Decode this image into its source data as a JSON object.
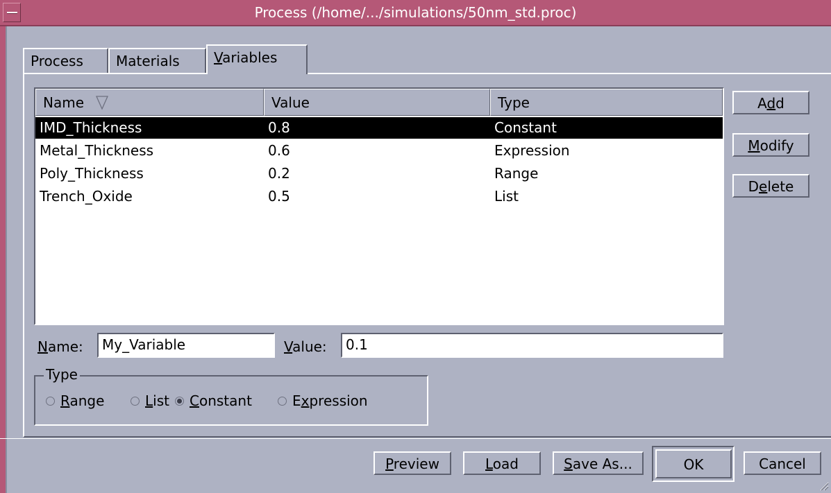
{
  "window": {
    "title": "Process (/home/.../simulations/50nm_std.proc)"
  },
  "tabs": [
    {
      "label": "Process",
      "active": false
    },
    {
      "label": "Materials",
      "active": false
    },
    {
      "label_pre": "",
      "label_mn": "V",
      "label_post": "ariables",
      "active": true
    }
  ],
  "table": {
    "columns": [
      {
        "label": "Name"
      },
      {
        "label": "Value"
      },
      {
        "label": "Type"
      }
    ],
    "sort_column": "Name",
    "rows": [
      {
        "name": "IMD_Thickness",
        "value": "0.8",
        "type": "Constant",
        "selected": true
      },
      {
        "name": "Metal_Thickness",
        "value": "0.6",
        "type": "Expression",
        "selected": false
      },
      {
        "name": "Poly_Thickness",
        "value": "0.2",
        "type": "Range",
        "selected": false
      },
      {
        "name": "Trench_Oxide",
        "value": "0.5",
        "type": "List",
        "selected": false
      }
    ]
  },
  "side_buttons": {
    "add": {
      "pre": "A",
      "mn": "d",
      "post": "d"
    },
    "modify": {
      "pre": "",
      "mn": "M",
      "post": "odify"
    },
    "delete": {
      "pre": "D",
      "mn": "e",
      "post": "lete"
    }
  },
  "form": {
    "name_label": {
      "mn": "N",
      "post": "ame:"
    },
    "name_value": "My_Variable",
    "value_label": {
      "mn": "V",
      "post": "alue:"
    },
    "value_value": "0.1"
  },
  "type_group": {
    "title": "Type",
    "options": [
      {
        "pre": "",
        "mn": "R",
        "post": "ange",
        "checked": false
      },
      {
        "pre": "",
        "mn": "L",
        "post": "ist",
        "checked": false
      },
      {
        "pre": "",
        "mn": "C",
        "post": "onstant",
        "checked": true
      },
      {
        "pre": "E",
        "mn": "x",
        "post": "pression",
        "checked": false
      }
    ]
  },
  "footer_buttons": {
    "preview": {
      "mn": "P",
      "post": "review"
    },
    "load": {
      "mn": "L",
      "post": "oad"
    },
    "save_as": {
      "mn": "S",
      "post": "ave As..."
    },
    "ok": "OK",
    "cancel": "Cancel"
  },
  "colors": {
    "titlebar": "#b55877",
    "dialog_bg": "#aeb2c3",
    "selection": "#000000"
  }
}
